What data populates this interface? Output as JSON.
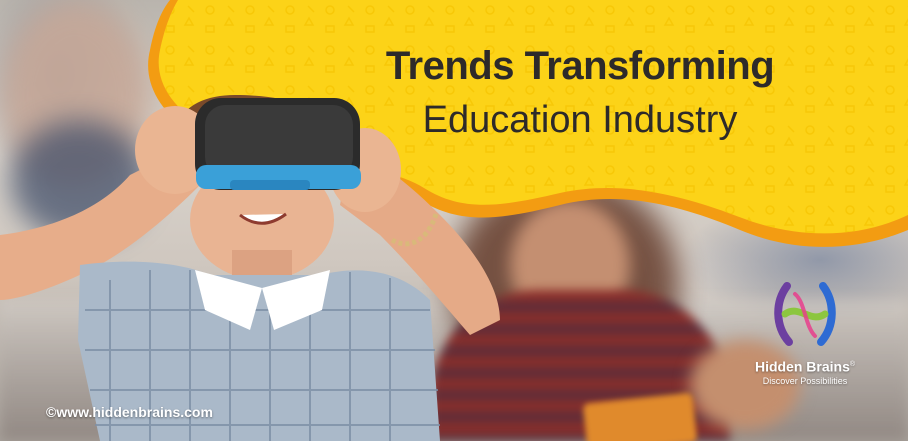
{
  "headline": {
    "line1": "Trends Transforming",
    "line2": "Education Industry"
  },
  "brand": {
    "name": "Hidden Brains",
    "registered_mark": "®",
    "tagline": "Discover Possibilities"
  },
  "footer": {
    "copyright": "©www.hiddenbrains.com"
  },
  "colors": {
    "banner_yellow": "#fcd318",
    "banner_orange": "#f39c12",
    "headline_text": "#2d2a2a",
    "logo_purple": "#6c3fa0",
    "logo_green": "#8cc63f",
    "logo_blue": "#2e6bd3"
  }
}
